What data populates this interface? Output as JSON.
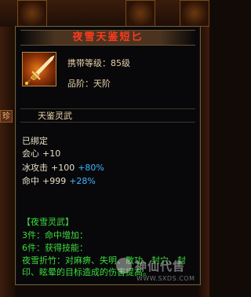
{
  "background": {
    "tab_left": "珍"
  },
  "item": {
    "name": "夜雪天鉴短匕",
    "icon": "dagger-icon",
    "level_label": "携带等级：",
    "level_value": "85级",
    "grade_label": "品阶：",
    "grade_value": "天阶"
  },
  "set_name": "天鉴灵武",
  "status": "已绑定",
  "stats": [
    {
      "name": "会心",
      "value": "+10",
      "bonus": ""
    },
    {
      "name": "冰攻击",
      "value": "+100",
      "bonus": "+80%"
    },
    {
      "name": "命中",
      "value": "+999",
      "bonus": "+28%"
    }
  ],
  "set_bonus": {
    "title": "【夜雪灵武】",
    "lines": [
      "3件：命中增加：",
      "6件：获得技能：",
      "夜雪折竹：对麻痹、失明、散功、封穴、封印、眩晕的目标造成的伤害提高。"
    ]
  },
  "watermark": {
    "text": "神仙代售",
    "url": "WWW.SXDS.COM"
  },
  "colors": {
    "title": "#ff3a1e",
    "bonus": "#3cb8ff",
    "set": "#3cdc3c"
  }
}
